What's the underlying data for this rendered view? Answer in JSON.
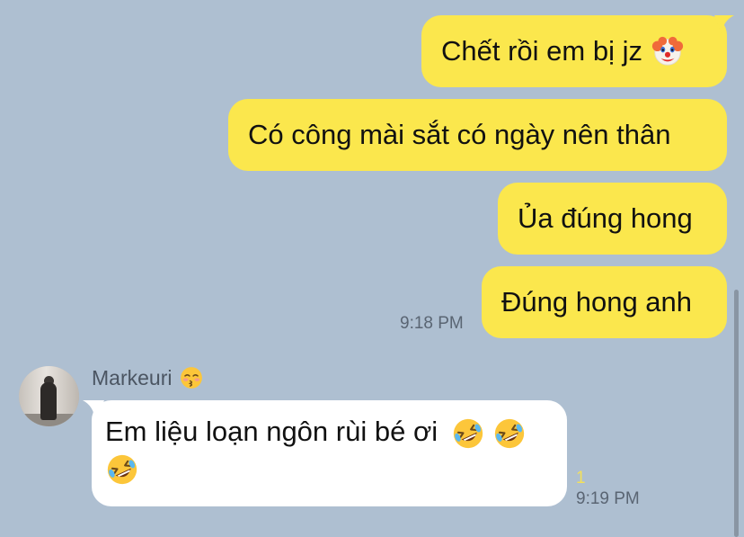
{
  "messages_out": [
    {
      "text": "Chết rồi em bị jz",
      "emoji": "clown-face"
    },
    {
      "text": "Có công mài sắt có ngày nên thân"
    },
    {
      "text": "Ủa đúng hong"
    },
    {
      "text": "Đúng hong anh"
    }
  ],
  "out_time": "9:18 PM",
  "incoming": {
    "sender": "Markeuri",
    "sender_emoji": "kissing-face-closed-eyes",
    "text": "Em liệu loạn ngôn rùi bé ơi",
    "emojis": [
      "rolling-on-floor-laughing",
      "rolling-on-floor-laughing",
      "rolling-on-floor-laughing"
    ],
    "read_count": "1",
    "time": "9:19 PM"
  },
  "colors": {
    "background": "#aebfd1",
    "outgoing_bubble": "#fbe74d",
    "incoming_bubble": "#ffffff",
    "read_count": "#f3e05a"
  }
}
